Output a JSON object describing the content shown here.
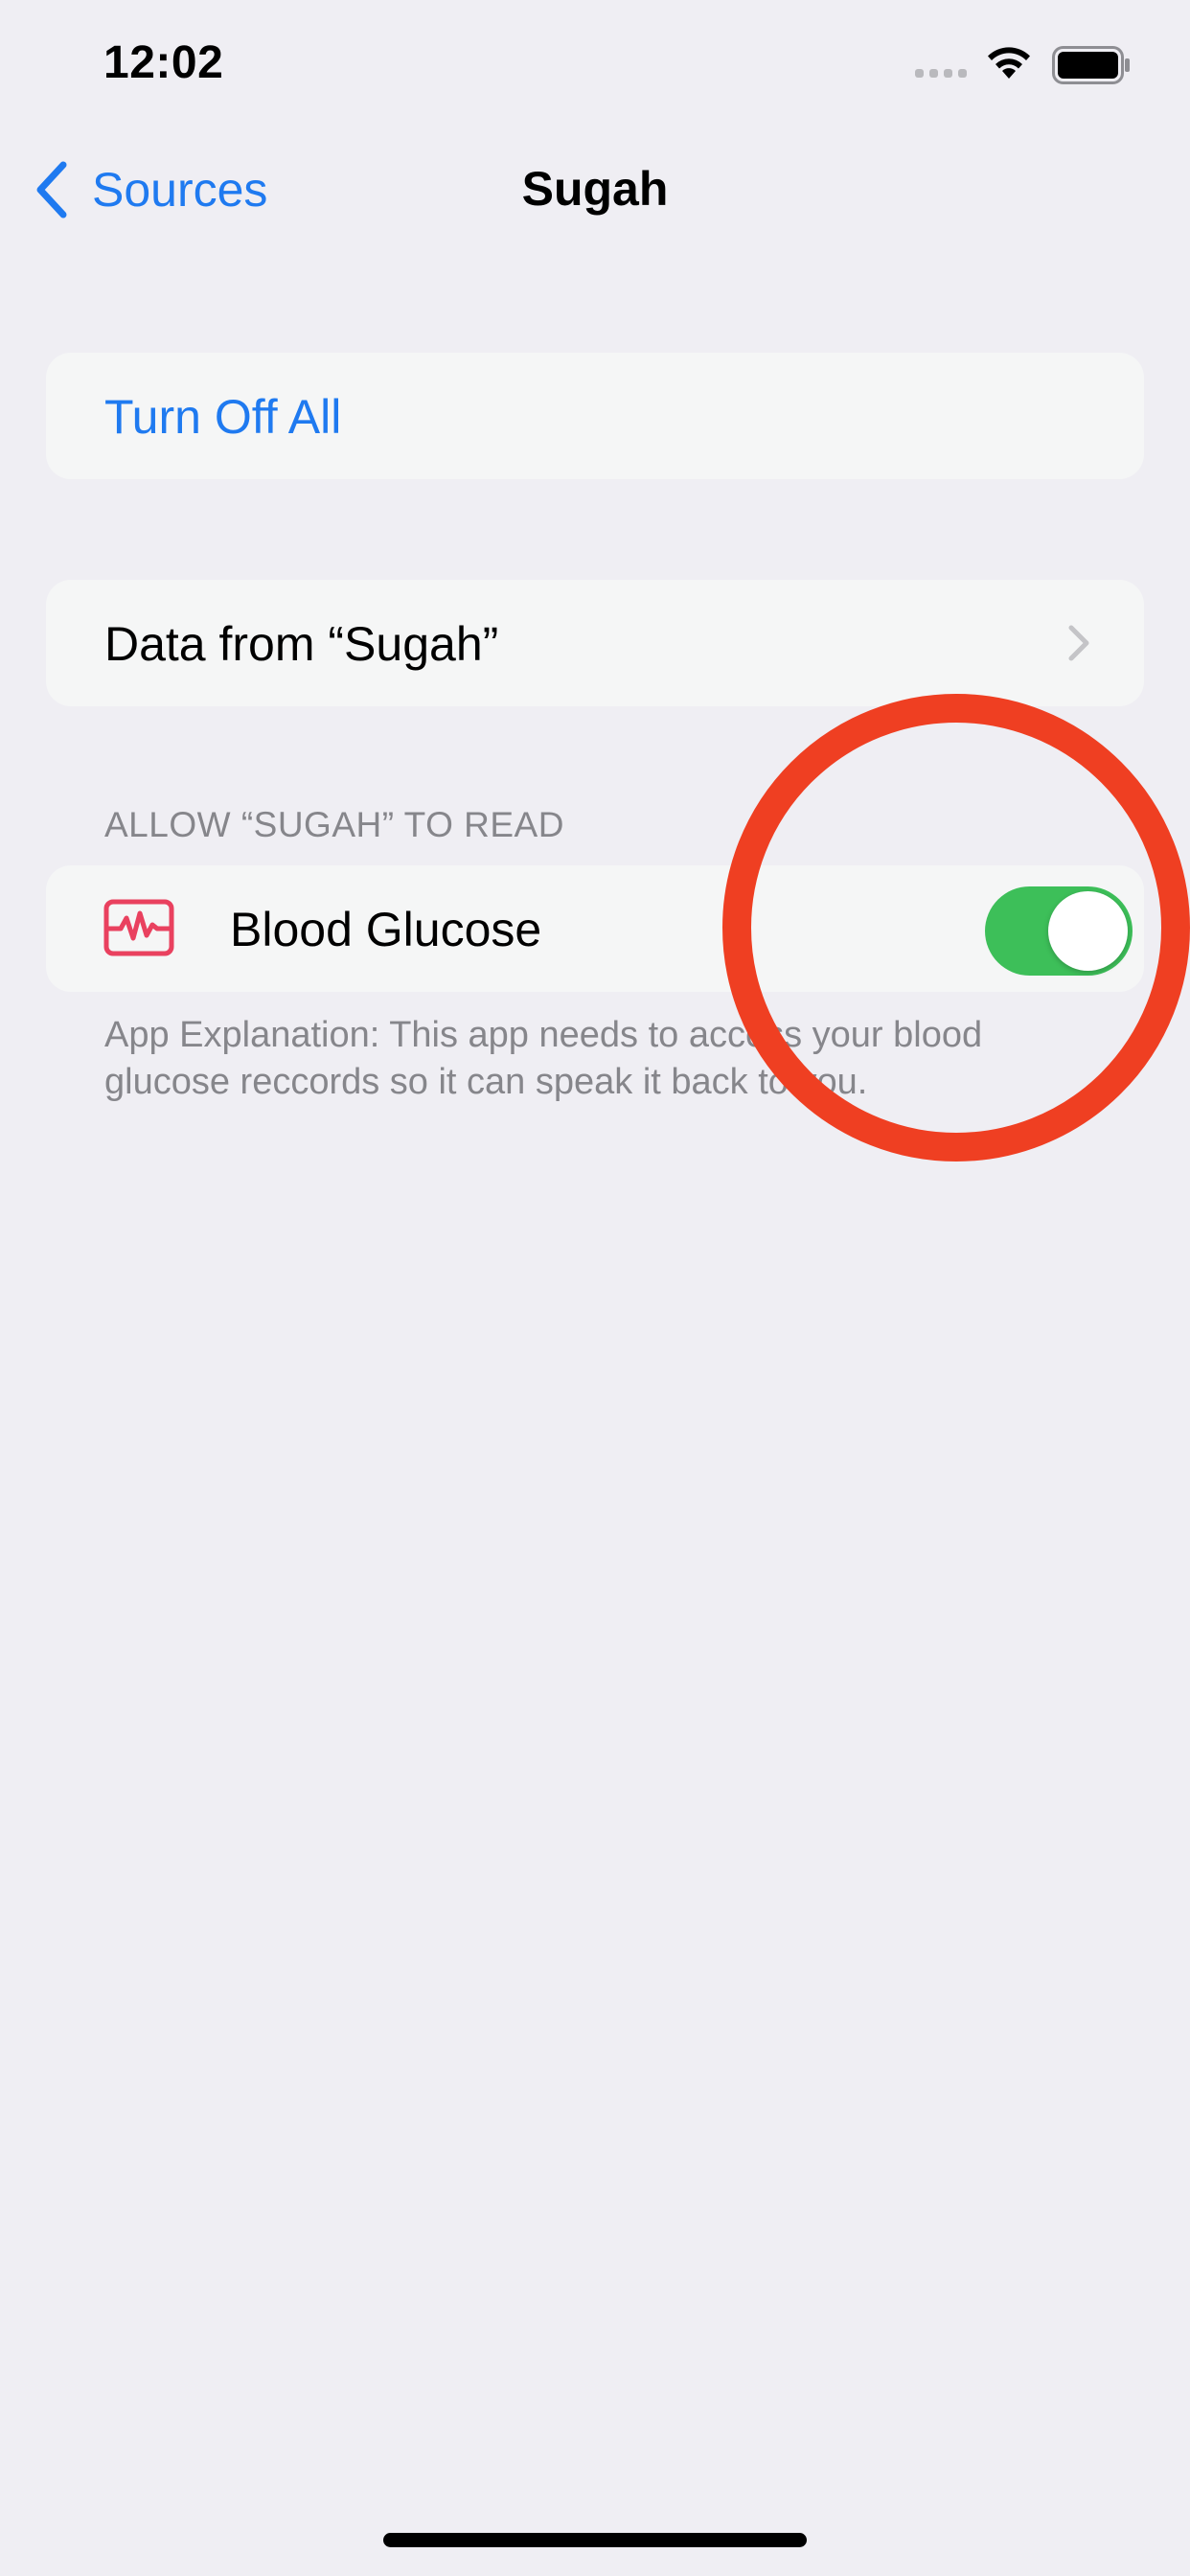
{
  "status_bar": {
    "time": "12:02",
    "icons": [
      "cellular-signal-icon",
      "wifi-icon",
      "battery-icon"
    ]
  },
  "nav": {
    "back_label": "Sources",
    "title": "Sugah"
  },
  "turn_off_all": {
    "label": "Turn Off All"
  },
  "data_row": {
    "label": "Data from “Sugah”"
  },
  "read_section": {
    "header": "ALLOW “SUGAH” TO READ",
    "items": [
      {
        "label": "Blood Glucose",
        "icon": "blood-glucose-icon",
        "enabled": true
      }
    ],
    "explanation": "App Explanation: This app needs to access your blood glucose reccords so it can speak it back to you."
  },
  "colors": {
    "accent": "#1f7af0",
    "toggle_on": "#3dbf59",
    "glucose_icon": "#e9415f",
    "annotation": "#ef3f22",
    "background": "#efeef3",
    "card": "#f5f6f6",
    "secondary_text": "#86868b"
  }
}
